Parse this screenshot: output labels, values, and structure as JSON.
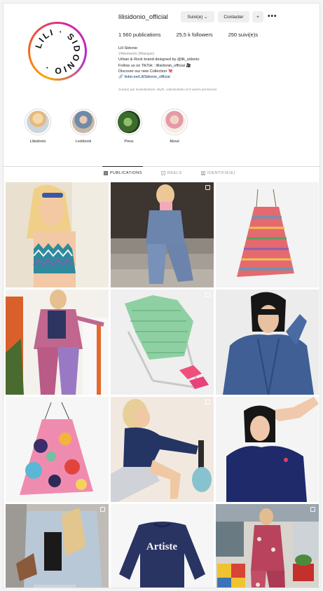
{
  "profile": {
    "username": "lilisidonio_official",
    "follow_button": "Suivi(e) ⌄",
    "contact_button": "Contacter",
    "add_button": "+",
    "more_glyph": "•••",
    "logo_text": "LILI SIDONIO",
    "stats": {
      "posts": "1 560 publications",
      "followers": "25,5 k followers",
      "following": "250 suivi(e)s"
    },
    "bio": {
      "name": "Lili Sidonio",
      "category": "Vêtements (Marque)",
      "line1": "Urban & Rock brand designed by @lili_sidonio",
      "line2": "Follow us on TikTok : lilisidonio_official 🎥",
      "line3": "Discover our new Collection 💘",
      "link": "linktr.ee/LiliSidonio_official"
    },
    "followed_by": "Suivi(e) par louisettestore, oliyfri, valentinsteku et 8 autres personnes"
  },
  "highlights": [
    {
      "label": "Lilisidonio",
      "icon": "highlight-lilisidonio"
    },
    {
      "label": "Lookbook",
      "icon": "highlight-lookbook"
    },
    {
      "label": "Press",
      "icon": "highlight-press"
    },
    {
      "label": "About",
      "icon": "highlight-about"
    }
  ],
  "tabs": [
    {
      "label": "PUBLICATIONS",
      "icon": "grid-icon",
      "active": true
    },
    {
      "label": "REELS",
      "icon": "reels-icon",
      "active": false
    },
    {
      "label": "IDENTIFIÉ(E)",
      "icon": "tagged-icon",
      "active": false
    }
  ],
  "posts": [
    {
      "name": "post-zigzag-top",
      "badge": false
    },
    {
      "name": "post-denim-set-stairs",
      "badge": true
    },
    {
      "name": "post-striped-dress",
      "badge": false
    },
    {
      "name": "post-paisley-suit",
      "badge": false
    },
    {
      "name": "post-green-shirt-chair",
      "badge": true
    },
    {
      "name": "post-denim-jacket",
      "badge": false
    },
    {
      "name": "post-floral-dress",
      "badge": false
    },
    {
      "name": "post-navy-sweater-crouch",
      "badge": true
    },
    {
      "name": "post-navy-tee",
      "badge": false
    },
    {
      "name": "post-denim-jacket-back",
      "badge": true
    },
    {
      "name": "post-artiste-sweatshirt",
      "badge": false,
      "print_text": "Artiste"
    },
    {
      "name": "post-printed-suit-chairs",
      "badge": true
    }
  ],
  "colors": {
    "ring_gradient": [
      "#f9a600",
      "#f15b2a",
      "#d6249f",
      "#b12dcc"
    ],
    "link": "#00376b",
    "muted": "#8e8e8e"
  }
}
